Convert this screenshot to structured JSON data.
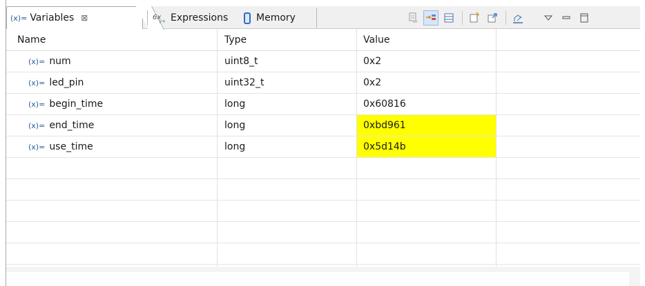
{
  "tabs": [
    {
      "icon": "variables-icon",
      "prefix": "(x)=",
      "label": "Variables",
      "close": "⊠",
      "active": true
    },
    {
      "icon": "expressions-icon",
      "label": "Expressions",
      "active": false
    },
    {
      "icon": "memory-icon",
      "label": "Memory",
      "active": false
    }
  ],
  "toolbar": {
    "buttons": [
      "collapse-all-icon",
      "show-type-names-icon",
      "layout-icon",
      "add-watch-icon",
      "expression-icon",
      "link-icon"
    ],
    "menu": "view-menu-icon",
    "minimize": "minimize-icon",
    "maximize": "maximize-icon"
  },
  "table": {
    "columns": [
      "Name",
      "Type",
      "Value"
    ],
    "var_prefix": "(x)=",
    "rows": [
      {
        "name": "num",
        "type": "uint8_t",
        "value": "0x2",
        "changed": false
      },
      {
        "name": "led_pin",
        "type": "uint32_t",
        "value": "0x2",
        "changed": false
      },
      {
        "name": "begin_time",
        "type": "long",
        "value": "0x60816",
        "changed": false
      },
      {
        "name": "end_time",
        "type": "long",
        "value": "0xbd961",
        "changed": true
      },
      {
        "name": "use_time",
        "type": "long",
        "value": "0x5d14b",
        "changed": true
      }
    ]
  },
  "colors": {
    "changed_highlight": "#ffff00",
    "accent": "#2c5b9e"
  }
}
